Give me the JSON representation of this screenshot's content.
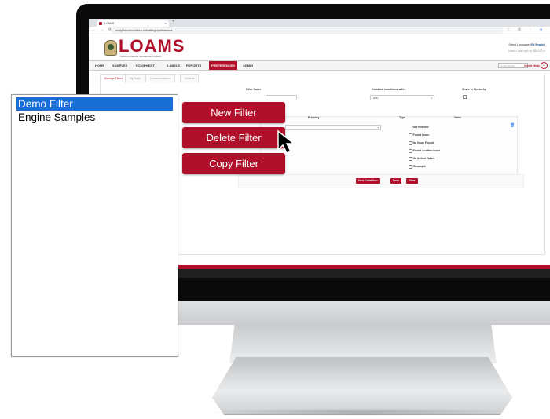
{
  "browser": {
    "tab_title": "LOAMS",
    "tab_close": "×",
    "new_tab": "+",
    "url": "analysisloomsolutions.net/settings/preferences"
  },
  "app": {
    "logo_text": "LOAMS",
    "logo_subtitle": "Lube-Oil Analysis Management System",
    "language_label": "Select Language:",
    "language_value": "EN English",
    "user_line": "Admin ▾   Last login on 08/24/2019",
    "nav": [
      "HOME",
      "SAMPLES",
      "EQUIPMENT",
      "LABELS",
      "REPORTS",
      "PREFERENCES",
      "ADMIN"
    ],
    "active_nav": "PREFERENCES",
    "quick_search_placeholder": "Quick Search",
    "need_help": "Need Help",
    "need_help_icon": "?"
  },
  "filter_page": {
    "subtabs": [
      "Manage Filters",
      "My Tools",
      "Communications",
      "General"
    ],
    "filter_name_label": "Filter Name :",
    "combine_label": "Combine conditions with :",
    "combine_value": "AND",
    "share_label": "Share in Hierarchy",
    "columns": [
      "Property",
      "Type",
      "Value"
    ],
    "type_options": [
      "Not Entered",
      "Found Issue",
      "No Issue Found",
      "Found Another Issue",
      "No Action Taken",
      "Resample"
    ],
    "buttons": [
      "New Condition",
      "Save",
      "Clear"
    ]
  },
  "filter_list": {
    "items": [
      "Demo Filter",
      "Engine Samples"
    ],
    "selected_index": 0
  },
  "actions": {
    "new_filter": "New Filter",
    "delete_filter": "Delete Filter",
    "copy_filter": "Copy Filter"
  },
  "colors": {
    "brand_red": "#b0102a",
    "selection_blue": "#1a6fd6"
  }
}
